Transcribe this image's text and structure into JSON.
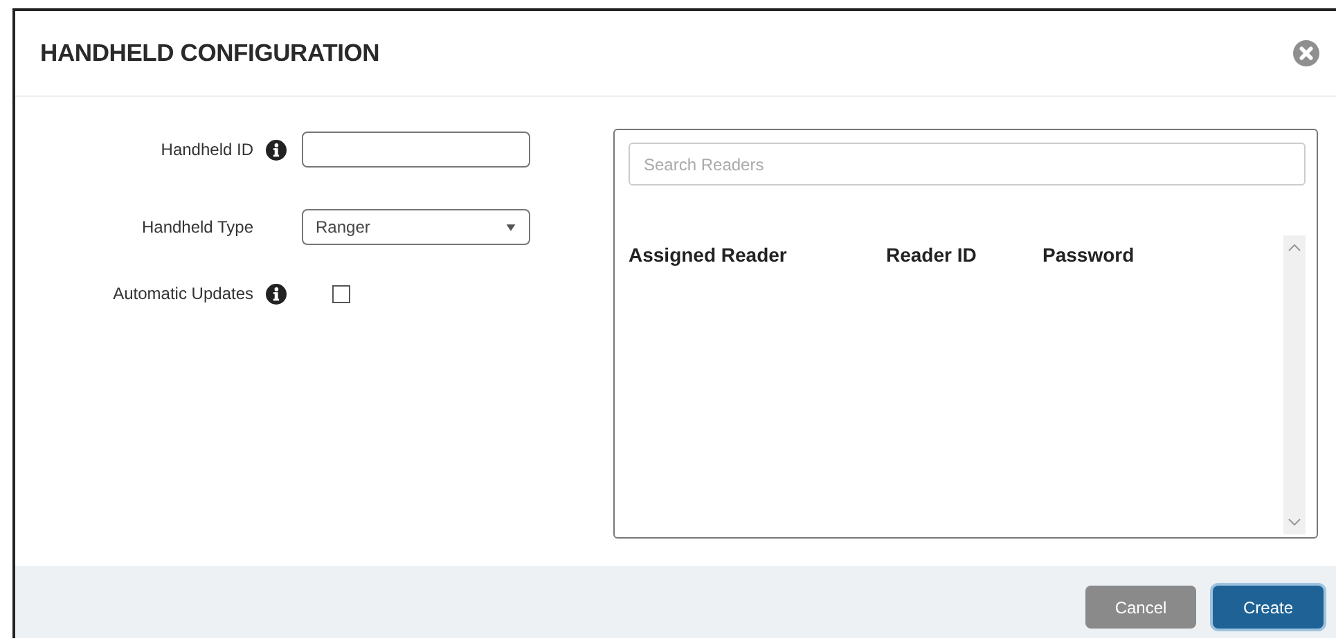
{
  "dialog": {
    "title": "HANDHELD CONFIGURATION"
  },
  "form": {
    "fields": [
      {
        "kind": "text",
        "label": "Handheld ID",
        "info": true
      },
      {
        "kind": "select",
        "label": "Handheld Type",
        "info": false,
        "value": "Ranger"
      },
      {
        "kind": "checkbox",
        "label": "Automatic Updates",
        "info": true,
        "checked": false
      }
    ]
  },
  "readers": {
    "search": {
      "placeholder": "Search Readers"
    },
    "columns": [
      "Assigned Reader",
      "Reader ID",
      "Password"
    ]
  },
  "buttons": [
    {
      "label": "Cancel",
      "kind": "secondary"
    },
    {
      "label": "Create",
      "kind": "primary"
    }
  ]
}
